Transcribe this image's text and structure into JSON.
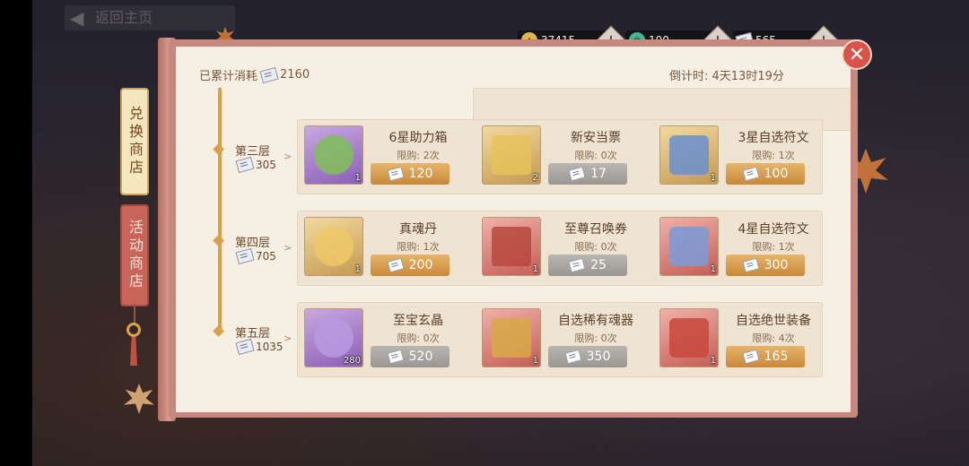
{
  "top_bar": {
    "back_label": "返回主页"
  },
  "currency": [
    {
      "icon": "gold-coin-icon",
      "value": "37415",
      "color": "#e2b64a"
    },
    {
      "icon": "jade-icon",
      "value": "100",
      "color": "#3fb89a"
    },
    {
      "icon": "ticket-icon",
      "value": "565",
      "color": "#dfe6ee"
    }
  ],
  "side_tabs": [
    {
      "label": "兑换商店",
      "active": true
    },
    {
      "label": "活动商店",
      "active": false
    }
  ],
  "header": {
    "spent_label": "已累计消耗",
    "spent_value": "2160",
    "countdown": "倒计时: 4天13时19分"
  },
  "tiers": [
    {
      "name": "第三层",
      "cost": "305"
    },
    {
      "name": "第四层",
      "cost": "705"
    },
    {
      "name": "第五层",
      "cost": "1035"
    }
  ],
  "rows": [
    [
      {
        "name": "6星助力箱",
        "limit": "限购: 2次",
        "price": "120",
        "qty": "1",
        "available": true,
        "bg": "purple"
      },
      {
        "name": "新安当票",
        "limit": "限购: 0次",
        "price": "17",
        "qty": "2",
        "available": false,
        "bg": "gold"
      },
      {
        "name": "3星自选符文",
        "limit": "限购: 1次",
        "price": "100",
        "qty": "1",
        "available": true,
        "bg": "gold"
      }
    ],
    [
      {
        "name": "真魂丹",
        "limit": "限购: 1次",
        "price": "200",
        "qty": "1",
        "available": true,
        "bg": "gold"
      },
      {
        "name": "至尊召唤券",
        "limit": "限购: 0次",
        "price": "25",
        "qty": "1",
        "available": false,
        "bg": "red"
      },
      {
        "name": "4星自选符文",
        "limit": "限购: 1次",
        "price": "300",
        "qty": "1",
        "available": true,
        "bg": "red"
      }
    ],
    [
      {
        "name": "至宝玄晶",
        "limit": "限购: 0次",
        "price": "520",
        "qty": "280",
        "available": false,
        "bg": "purple"
      },
      {
        "name": "自选稀有魂器",
        "limit": "限购: 0次",
        "price": "350",
        "qty": "1",
        "available": false,
        "bg": "red"
      },
      {
        "name": "自选绝世装备",
        "limit": "限购: 4次",
        "price": "165",
        "qty": "1",
        "available": true,
        "bg": "red"
      }
    ]
  ]
}
